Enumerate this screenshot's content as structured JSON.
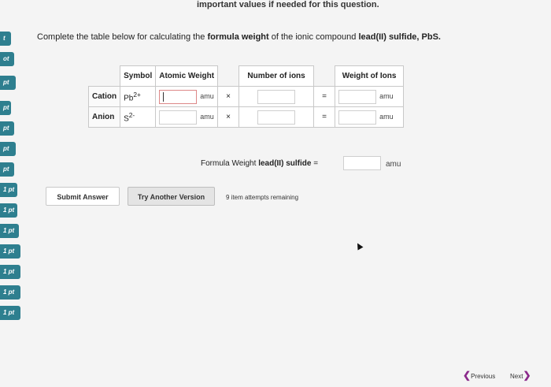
{
  "top_note": "important values if needed for this question.",
  "sidebar": {
    "items": [
      "t",
      "ot",
      "pt",
      "pt",
      "pt",
      "pt",
      "pt",
      "1 pt",
      "1 pt",
      "1 pt",
      "1 pt",
      "1 pt",
      "1 pt",
      "1 pt"
    ]
  },
  "question": {
    "prefix": "Complete the table below for calculating the ",
    "bold1": "formula weight",
    "mid": " of the ionic compound ",
    "compound": "lead(II) sulfide, PbS."
  },
  "table": {
    "headers": {
      "symbol": "Symbol",
      "atomic_weight": "Atomic Weight",
      "number_of_ions": "Number of ions",
      "weight_of_ions": "Weight of Ions"
    },
    "rows": [
      {
        "label": "Cation",
        "symbol_base": "Pb",
        "symbol_sup": "2+",
        "unit": "amu",
        "times": "×",
        "equals": "=",
        "unit2": "amu"
      },
      {
        "label": "Anion",
        "symbol_base": "S",
        "symbol_sup": "2-",
        "unit": "amu",
        "times": "×",
        "equals": "=",
        "unit2": "amu"
      }
    ]
  },
  "formula_weight": {
    "prefix": "Formula Weight ",
    "compound": "lead(II) sulfide",
    "equals": " =",
    "unit": "amu"
  },
  "buttons": {
    "submit": "Submit Answer",
    "another": "Try Another Version"
  },
  "attempts": "9 item attempts remaining",
  "nav": {
    "previous": "Previous",
    "next": "Next"
  },
  "colors": {
    "sidebar_tab": "#2e7f8f",
    "accent": "#8b2a8b"
  }
}
